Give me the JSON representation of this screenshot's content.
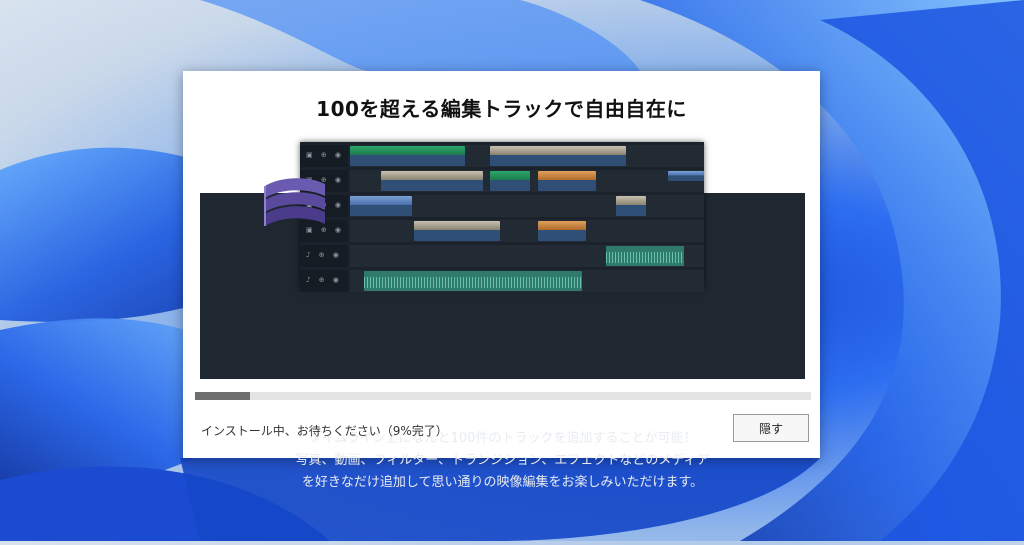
{
  "installer": {
    "title": "100を超える編集トラックで自由自在に",
    "description_lines": [
      "タイムライン上になんと100件のトラックを追加することが可能！",
      "写真、動画、フィルター、トランジション、エフェクトなどのメディア",
      "を好きなだけ追加して思い通りの映像編集をお楽しみいただけます。"
    ],
    "progress_percent": 9,
    "status_text": "インストール中、お待ちください（9%完了）",
    "hide_button_label": "隠す"
  },
  "colors": {
    "banner_background": "#1f2731",
    "progress_fill": "#6e6e6e",
    "progress_track": "#e4e4e4"
  }
}
